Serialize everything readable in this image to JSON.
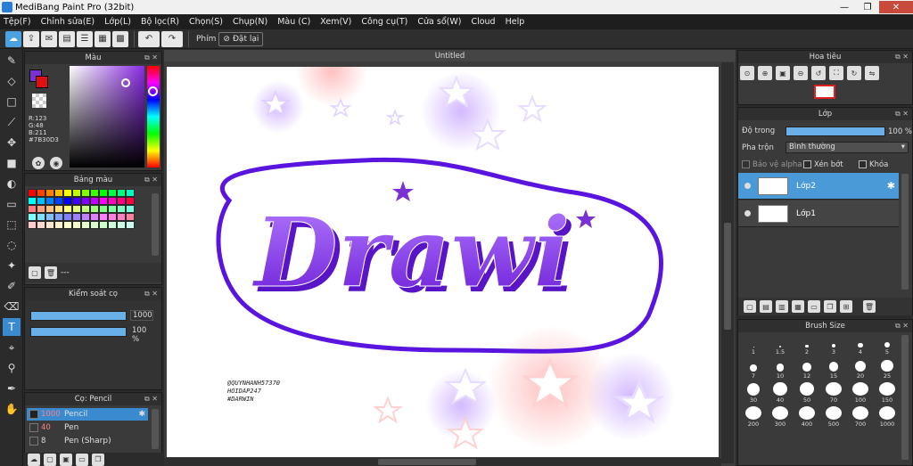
{
  "window": {
    "title": "MediBang Paint Pro (32bit)",
    "min": "—",
    "max": "❐",
    "close": "✕"
  },
  "menu": [
    "Tệp(F)",
    "Chỉnh sửa(E)",
    "Lớp(L)",
    "Bộ lọc(R)",
    "Chọn(S)",
    "Chụp(N)",
    "Màu (C)",
    "Xem(V)",
    "Công cụ(T)",
    "Cửa sổ(W)",
    "Cloud",
    "Help"
  ],
  "toolbar": {
    "phim_label": "Phím",
    "reset_label": "Đặt lại"
  },
  "color_panel": {
    "title": "Màu",
    "fg": "#7B30D3",
    "bg": "#E01010",
    "r": "R:123",
    "g": "G:48",
    "b": "B:211",
    "hex": "#7B30D3"
  },
  "palette_panel": {
    "title": "Bảng màu",
    "dash": "---"
  },
  "brush_control": {
    "title": "Kiểm soát cọ",
    "size": "1000",
    "opacity": "100 %"
  },
  "brush_panel": {
    "title": "Cọ: Pencil",
    "items": [
      {
        "size": "1000",
        "name": "Pencil"
      },
      {
        "size": "40",
        "name": "Pen"
      },
      {
        "size": "8",
        "name": "Pen (Sharp)"
      }
    ]
  },
  "canvas": {
    "title": "Untitled",
    "art_text": "Drawi",
    "credit1": "@QUYNHANH57370",
    "credit2": "HOIDAP247",
    "credit3": "#DARWIN"
  },
  "navigator": {
    "title": "Hoa tiêu"
  },
  "layer_panel": {
    "title": "Lớp",
    "opacity_label": "Độ trong",
    "opacity_value": "100 %",
    "blend_label": "Pha trộn",
    "blend_value": "Bình thường",
    "alpha_label": "Bảo vệ alpha",
    "clip_label": "Xén bớt",
    "lock_label": "Khóa",
    "layers": [
      {
        "name": "Lớp2"
      },
      {
        "name": "Lớp1"
      }
    ]
  },
  "brush_size": {
    "title": "Brush Size",
    "sizes": [
      "1",
      "1.5",
      "2",
      "3",
      "4",
      "5",
      "7",
      "10",
      "12",
      "15",
      "20",
      "25",
      "30",
      "40",
      "50",
      "70",
      "100",
      "150",
      "200",
      "300",
      "400",
      "500",
      "700",
      "1000"
    ]
  },
  "palette_colors": [
    "#ff0000",
    "#ff4000",
    "#ff8000",
    "#ffbf00",
    "#ffff00",
    "#bfff00",
    "#80ff00",
    "#40ff00",
    "#00ff00",
    "#00ff40",
    "#00ff80",
    "#00ffbf",
    "#00ffff",
    "#00bfff",
    "#0080ff",
    "#0040ff",
    "#0000ff",
    "#4000ff",
    "#8000ff",
    "#bf00ff",
    "#ff00ff",
    "#ff00bf",
    "#ff0080",
    "#ff0040",
    "#ff8080",
    "#ffa080",
    "#ffc080",
    "#ffe080",
    "#ffff80",
    "#e0ff80",
    "#c0ff80",
    "#a0ff80",
    "#80ff80",
    "#80ffa0",
    "#80ffc0",
    "#80ffe0",
    "#80ffff",
    "#80e0ff",
    "#80c0ff",
    "#80a0ff",
    "#8080ff",
    "#a080ff",
    "#c080ff",
    "#e080ff",
    "#ff80ff",
    "#ff80e0",
    "#ff80c0",
    "#ff80a0",
    "#ffcccc",
    "#ffd9cc",
    "#ffe6cc",
    "#fff2cc",
    "#ffffcc",
    "#f2ffcc",
    "#e6ffcc",
    "#d9ffcc",
    "#ccffcc",
    "#ccffd9",
    "#ccffe6",
    "#ccfff2"
  ]
}
